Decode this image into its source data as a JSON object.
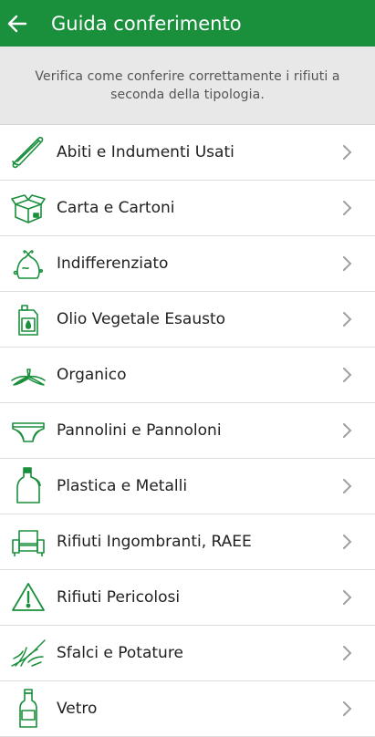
{
  "appbar": {
    "title": "Guida conferimento",
    "back_icon": "arrow-left-icon",
    "color": "#1a8f3c"
  },
  "banner": {
    "text": "Verifica come conferire correttamente i rifiuti a seconda della tipologia."
  },
  "items": [
    {
      "label": "Abiti e Indumenti Usati",
      "icon": "clothes-hanger-icon"
    },
    {
      "label": "Carta e Cartoni",
      "icon": "cardboard-box-icon"
    },
    {
      "label": "Indifferenziato",
      "icon": "trash-bag-icon"
    },
    {
      "label": "Olio Vegetale Esausto",
      "icon": "oil-jug-icon"
    },
    {
      "label": "Organico",
      "icon": "banana-peel-icon"
    },
    {
      "label": "Pannolini e Pannoloni",
      "icon": "diaper-icon"
    },
    {
      "label": "Plastica e Metalli",
      "icon": "plastic-bottle-icon"
    },
    {
      "label": "Rifiuti Ingombranti, RAEE",
      "icon": "armchair-icon"
    },
    {
      "label": "Rifiuti Pericolosi",
      "icon": "warning-triangle-icon"
    },
    {
      "label": "Sfalci e Potature",
      "icon": "grass-clippings-icon"
    },
    {
      "label": "Vetro",
      "icon": "glass-bottle-icon"
    }
  ],
  "colors": {
    "accent": "#1a8f3c",
    "chevron": "#9e9e9e"
  }
}
